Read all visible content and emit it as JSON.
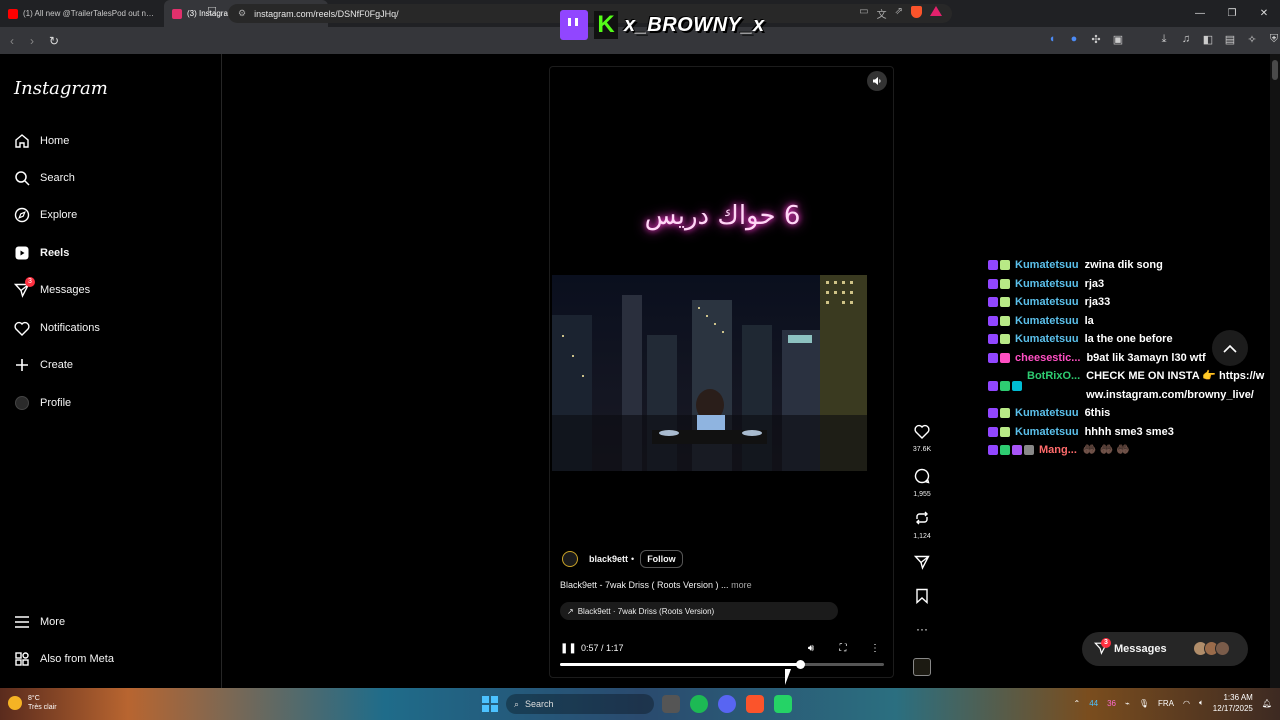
{
  "browser": {
    "tabs": [
      {
        "title": "(1) All new @TrailerTalesPod out now",
        "color": "#ff0000"
      },
      {
        "title": "(3) Instagram",
        "color": "#e1306c",
        "active": true
      },
      {
        "title": "(17) x_BROWNY_x - Twitch",
        "color": "#9146ff"
      },
      {
        "title": "Stream - K",
        "color": "#53fc18"
      },
      {
        "title": "STRM CHTW6 3FWi",
        "color": "#5865f2"
      },
      {
        "title": "- Restream",
        "color": "#3b82f6"
      }
    ],
    "url": "instagram.com/reels/DSNfF0FgJHq/"
  },
  "overlay": {
    "streamer": "x_BROWNY_x"
  },
  "instagram": {
    "logo": "Instagram",
    "nav": [
      {
        "label": "Home",
        "icon": "home-icon"
      },
      {
        "label": "Search",
        "icon": "search-icon"
      },
      {
        "label": "Explore",
        "icon": "explore-icon"
      },
      {
        "label": "Reels",
        "icon": "reels-icon"
      },
      {
        "label": "Messages",
        "icon": "messages-icon",
        "badge": "3"
      },
      {
        "label": "Notifications",
        "icon": "heart-icon"
      },
      {
        "label": "Create",
        "icon": "plus-icon"
      },
      {
        "label": "Profile",
        "icon": "avatar"
      }
    ],
    "more": "More",
    "also_from_meta": "Also from Meta"
  },
  "reel": {
    "overlay_text": "6 حواك دريس",
    "creator": "black9ett",
    "dot": "•",
    "follow": "Follow",
    "caption": "Black9ett - 7wak Driss ( Roots Version ) ...",
    "more": "more",
    "audio": "Black9ett · 7wak Driss (Roots Version)",
    "time": "0:57 / 1:17",
    "progress": 0.74,
    "likes": "37.6K",
    "comments": "1,955",
    "reposts": "1,124"
  },
  "chat": [
    {
      "user": "Kumatetsuu",
      "color": "#5bc0eb",
      "text": "zwina dik song",
      "badges": [
        "#9146ff",
        "#b8e986"
      ]
    },
    {
      "user": "Kumatetsuu",
      "color": "#5bc0eb",
      "text": "rja3",
      "badges": [
        "#9146ff",
        "#b8e986"
      ]
    },
    {
      "user": "Kumatetsuu",
      "color": "#5bc0eb",
      "text": "rja33",
      "badges": [
        "#9146ff",
        "#b8e986"
      ]
    },
    {
      "user": "Kumatetsuu",
      "color": "#5bc0eb",
      "text": "la",
      "badges": [
        "#9146ff",
        "#b8e986"
      ]
    },
    {
      "user": "Kumatetsuu",
      "color": "#5bc0eb",
      "text": "la the one before",
      "badges": [
        "#9146ff",
        "#b8e986"
      ]
    },
    {
      "user": "cheesestic...",
      "color": "#ff4fc3",
      "text": "b9at lik 3amayn l30 wtf",
      "badges": [
        "#9146ff",
        "#ff4fc3"
      ]
    },
    {
      "user": "BotRixO...",
      "color": "#2ecc71",
      "text": "CHECK ME ON INSTA 👉 https://www.instagram.com/browny_live/",
      "badges": [
        "#9146ff",
        "#2ecc71",
        "#00bcd4"
      ]
    },
    {
      "user": "Kumatetsuu",
      "color": "#5bc0eb",
      "text": "6this",
      "badges": [
        "#9146ff",
        "#b8e986"
      ]
    },
    {
      "user": "Kumatetsuu",
      "color": "#5bc0eb",
      "text": "hhhh sme3 sme3",
      "badges": [
        "#9146ff",
        "#b8e986"
      ]
    },
    {
      "user": "Mang...",
      "color": "#ff6b6b",
      "text": "🤲🏿 🤲🏿 🤲🏿",
      "badges": [
        "#9146ff",
        "#2ecc71",
        "#a855f7",
        "#888888"
      ]
    }
  ],
  "messages_pill": {
    "label": "Messages",
    "badge": "3"
  },
  "taskbar": {
    "temp": "8°C",
    "weather": "Très clair",
    "search": "Search",
    "tray_a": "44",
    "tray_b": "36",
    "lang": "FRA",
    "time": "1:36 AM",
    "date": "12/17/2025"
  }
}
